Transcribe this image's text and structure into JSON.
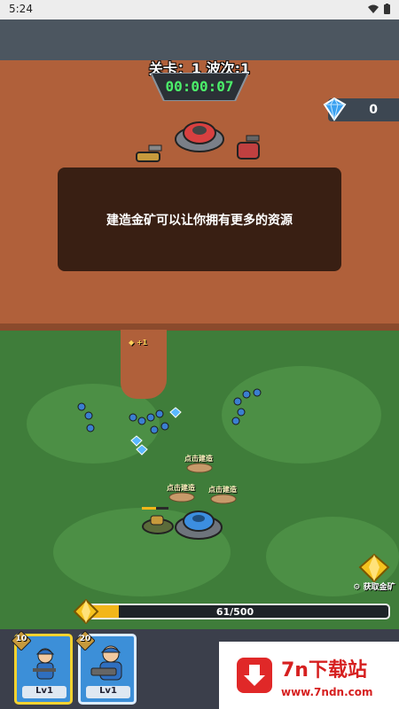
{
  "status_bar": {
    "time": "5:24"
  },
  "hud": {
    "level_text": "关卡：1 波次:1",
    "timer": "00:00:07",
    "gem_count": "0"
  },
  "tip": {
    "message": "建造金矿可以让你拥有更多的资源"
  },
  "map_labels": {
    "gold_plus": "+1",
    "build_spots": [
      "点击建造",
      "点击建造",
      "点击建造"
    ]
  },
  "gold_mine_button": {
    "label": "获取金矿"
  },
  "progress": {
    "text": "61/500",
    "fraction": 0.122
  },
  "cards": [
    {
      "cost": "10",
      "level": "Lv1"
    },
    {
      "cost": "20",
      "level": "Lv1"
    }
  ],
  "ad": {
    "title": "7n下载站",
    "url": "www.7ndn.com"
  },
  "colors": {
    "dirt": "#b0603a",
    "grass": "#3f7d3a",
    "accent_gold": "#f2b61a",
    "timer_green": "#4cf06a"
  }
}
